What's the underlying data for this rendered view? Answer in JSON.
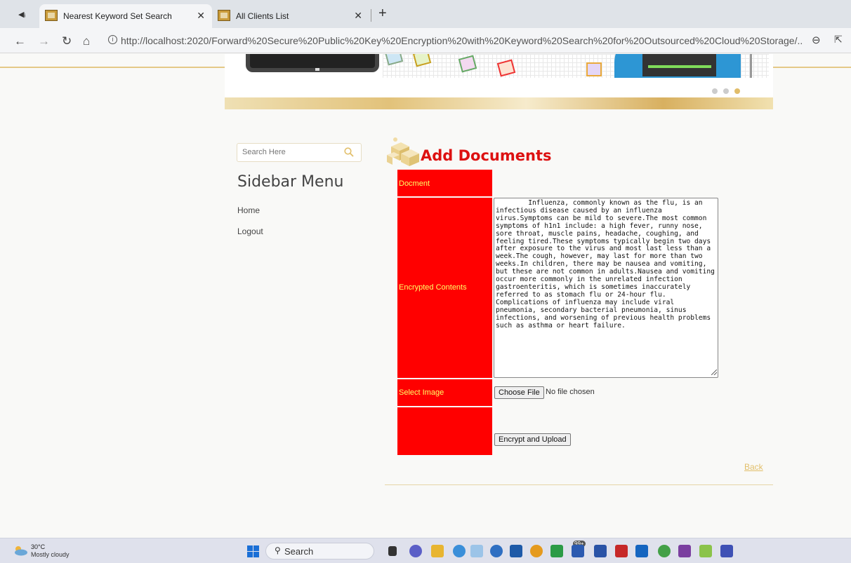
{
  "browser": {
    "tabs": [
      {
        "title": "Nearest Keyword Set Search",
        "active": true
      },
      {
        "title": "All Clients List",
        "active": false
      }
    ],
    "url": "http://localhost:2020/Forward%20Secure%20Public%20Key%20Encryption%20with%20Keyword%20Search%20for%20Outsourced%20Cloud%20Storage/...",
    "new_tab_label": "+"
  },
  "banner": {
    "slides": 3,
    "active_slide": 3
  },
  "sidebar": {
    "search_placeholder": "Search Here",
    "title": "Sidebar Menu",
    "items": [
      {
        "label": "Home"
      },
      {
        "label": "Logout"
      }
    ]
  },
  "main": {
    "title": "Add Documents",
    "form": {
      "document_label": "Docment",
      "encrypted_label": "Encrypted Contents",
      "encrypted_value": "        Influenza, commonly known as the flu, is an infectious disease caused by an influenza virus.Symptoms can be mild to severe.The most common symptoms of h1n1 include: a high fever, runny nose, sore throat, muscle pains, headache, coughing, and feeling tired.These symptoms typically begin two days after exposure to the virus and most last less than a week.The cough, however, may last for more than two weeks.In children, there may be nausea and vomiting, but these are not common in adults.Nausea and vomiting occur more commonly in the unrelated infection gastroenteritis, which is sometimes inaccurately referred to as stomach flu or 24-hour flu. Complications of influenza may include viral pneumonia, secondary bacterial pneumonia, sinus infections, and worsening of previous health problems such as asthma or heart failure.",
      "image_label": "Select Image",
      "file_button": "Choose File",
      "file_status": "No file chosen",
      "submit_button": "Encrypt and Upload"
    },
    "back_link": "Back"
  },
  "taskbar": {
    "weather_temp": "30°C",
    "weather_desc": "Mostly cloudy",
    "search_label": "Search",
    "badge": "99+"
  },
  "colors": {
    "label_bg": "#ff0000",
    "label_text": "#ffff66",
    "title_red": "#dd1111",
    "gold": "#e2bf6a"
  }
}
